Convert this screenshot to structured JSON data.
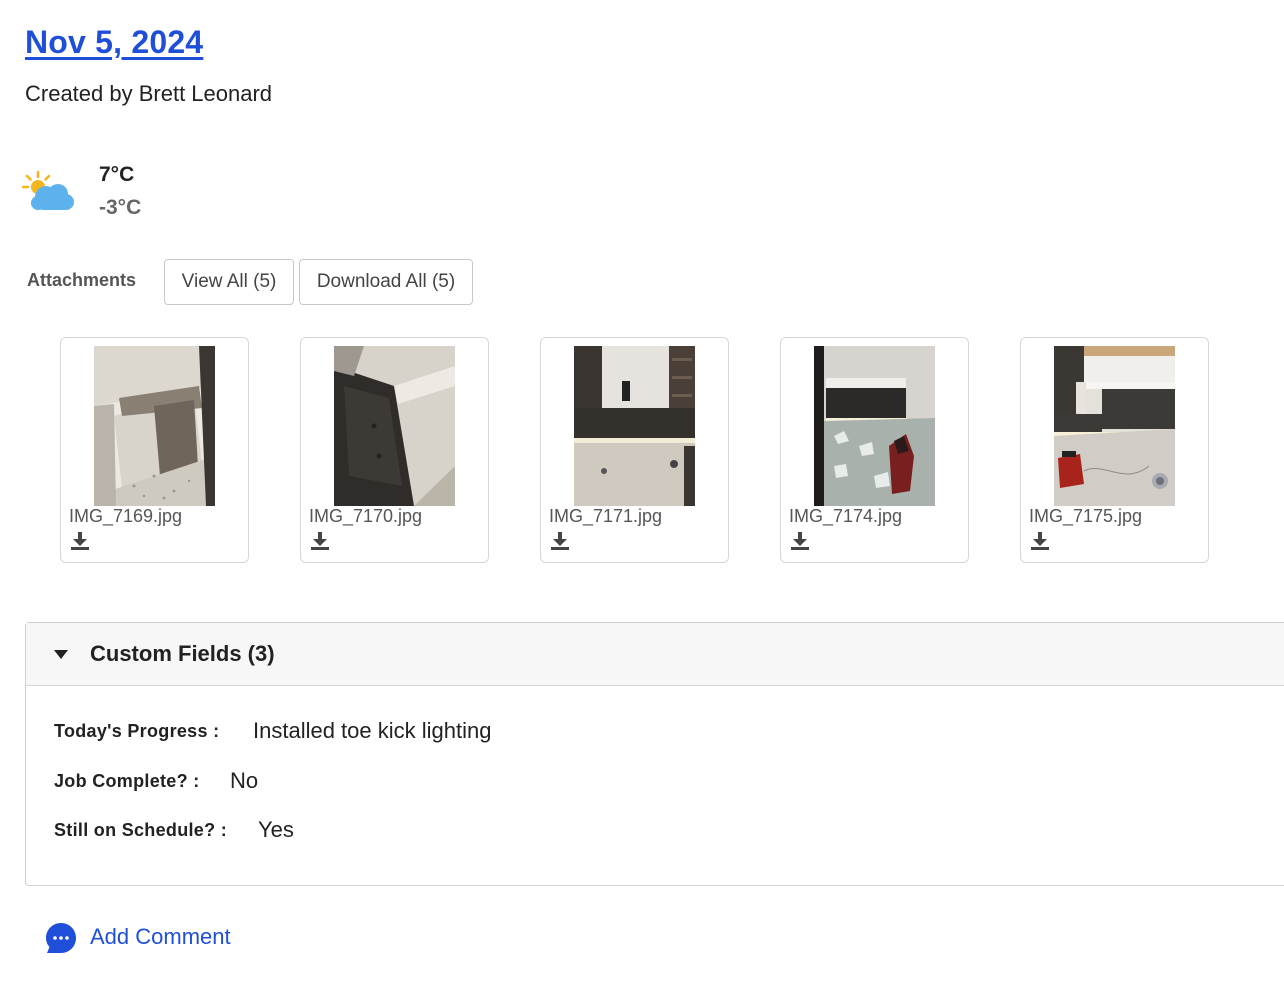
{
  "header": {
    "date": "Nov 5, 2024",
    "created_by": "Created by Brett Leonard"
  },
  "weather": {
    "icon": "partly-cloudy-icon",
    "high": "7°C",
    "low": "-3°C"
  },
  "attachments": {
    "label": "Attachments",
    "view_all": "View All (5)",
    "download_all": "Download All (5)",
    "files": [
      {
        "name": "IMG_7169.jpg",
        "icon": "download-icon"
      },
      {
        "name": "IMG_7170.jpg",
        "icon": "download-icon"
      },
      {
        "name": "IMG_7171.jpg",
        "icon": "download-icon"
      },
      {
        "name": "IMG_7174.jpg",
        "icon": "download-icon"
      },
      {
        "name": "IMG_7175.jpg",
        "icon": "download-icon"
      }
    ]
  },
  "custom_fields": {
    "title": "Custom Fields (3)",
    "expanded": true,
    "fields": [
      {
        "label": "Today's Progress :",
        "value": "Installed toe kick lighting"
      },
      {
        "label": "Job Complete? :",
        "value": "No"
      },
      {
        "label": "Still on Schedule? :",
        "value": "Yes"
      }
    ]
  },
  "comment": {
    "label": "Add Comment",
    "icon": "comment-bubble-icon"
  },
  "colors": {
    "link": "#1f4fd8",
    "muted": "#666666",
    "border": "#cfcfcf"
  }
}
